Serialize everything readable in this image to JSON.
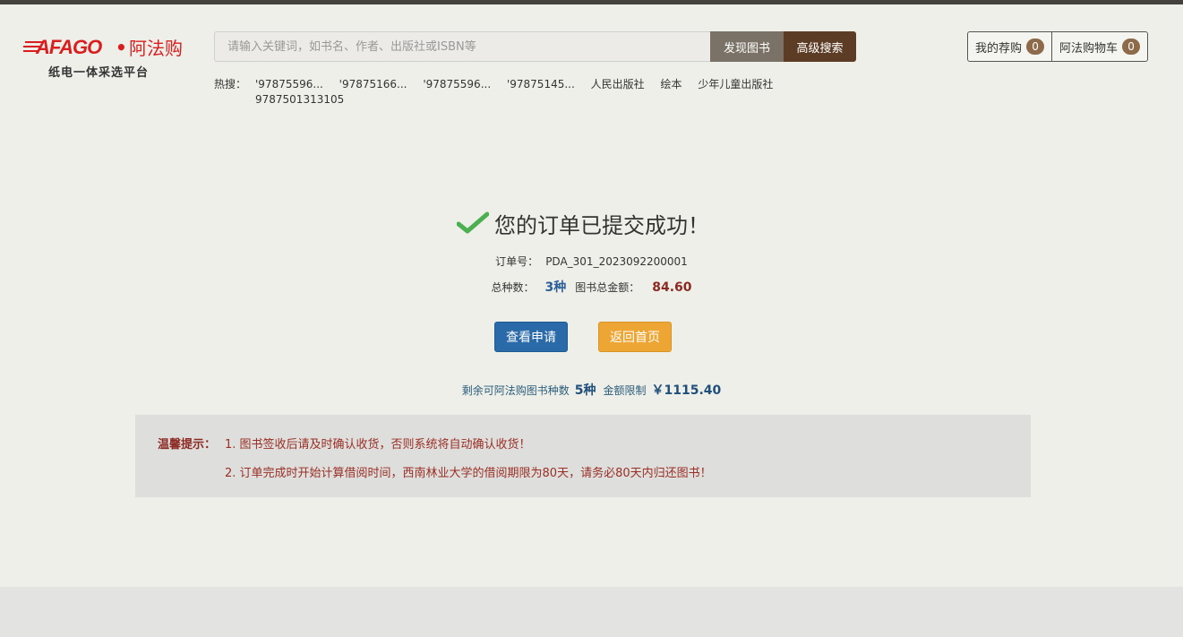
{
  "logo": {
    "brand": "AFAGO",
    "dot": "•",
    "name_cn": "阿法购",
    "tagline": "纸电一体采选平台"
  },
  "search": {
    "placeholder": "请输入关键词，如书名、作者、出版社或ISBN等",
    "discover_label": "发现图书",
    "advanced_label": "高级搜索"
  },
  "hot": {
    "label": "热搜：",
    "items": [
      "'97875596...",
      "'97875166...",
      "'97875596...",
      "'97875145...",
      "人民出版社",
      "绘本",
      "少年儿童出版社",
      "9787501313105"
    ]
  },
  "user_links": {
    "wishlist_label": "我的荐购",
    "wishlist_count": "0",
    "cart_label": "阿法购物车",
    "cart_count": "0"
  },
  "success": {
    "title": "您的订单已提交成功！",
    "order_no_label": "订单号：",
    "order_no": "PDA_301_2023092200001",
    "kinds_label": "总种数：",
    "kinds_value": "3种",
    "amount_label": "图书总金额：",
    "amount_value": "84.60",
    "view_button": "查看申请",
    "home_button": "返回首页",
    "remain_label": "剩余可阿法购图书种数",
    "remain_kinds": "5种",
    "limit_label": "金额限制",
    "limit_value": "￥1115.40"
  },
  "tips": {
    "label": "温馨提示：",
    "items": [
      "1. 图书签收后请及时确认收货，否则系统将自动确认收货！",
      "2. 订单完成时开始计算借阅时间，西南林业大学的借阅期限为80天，请务必80天内归还图书！"
    ]
  },
  "colors": {
    "brand_red": "#d81e1e",
    "primary_blue": "#2a6aa9",
    "accent_orange": "#eda534",
    "check_green": "#4caf50",
    "tip_red": "#9a2f24"
  }
}
